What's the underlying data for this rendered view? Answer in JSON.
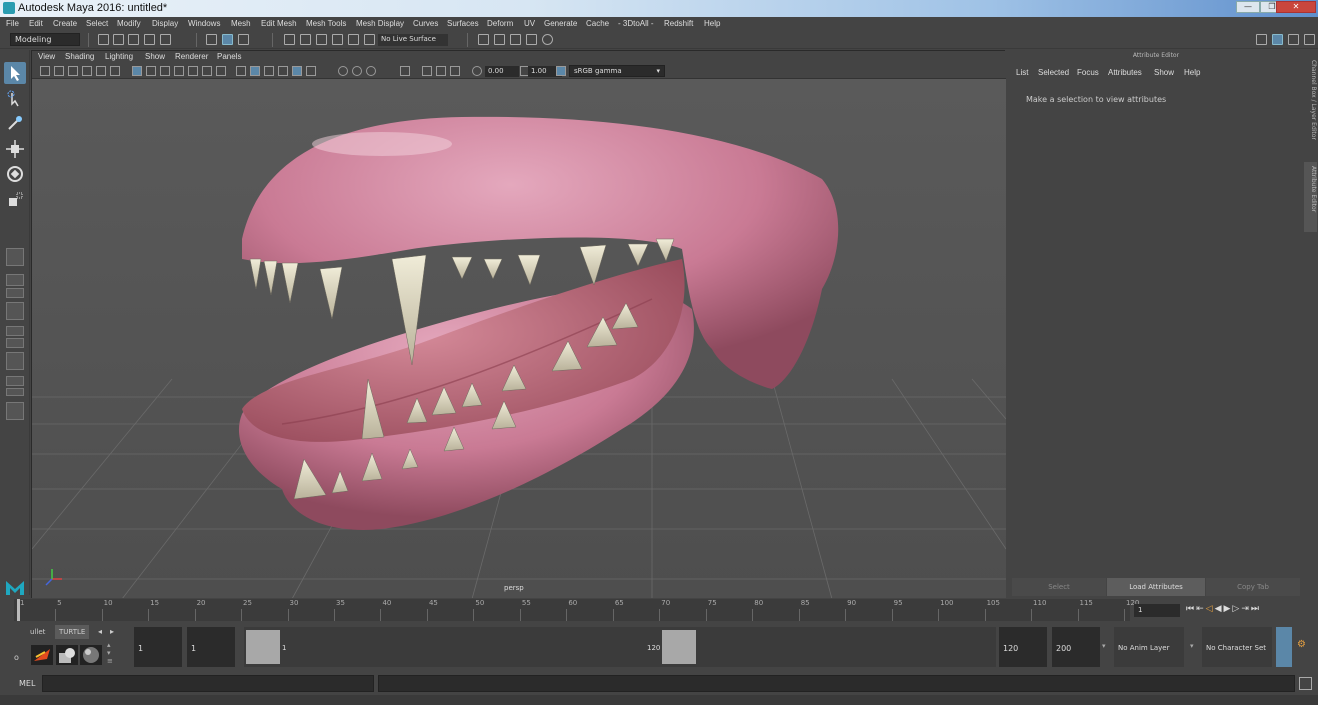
{
  "window": {
    "title": "Autodesk Maya 2016: untitled*"
  },
  "menubar": [
    "File",
    "Edit",
    "Create",
    "Select",
    "Modify",
    "Display",
    "Windows",
    "Mesh",
    "Edit Mesh",
    "Mesh Tools",
    "Mesh Display",
    "Curves",
    "Surfaces",
    "Deform",
    "UV",
    "Generate",
    "Cache",
    "- 3DtoAll -",
    "Redshift",
    "Help"
  ],
  "shelf": {
    "mode": "Modeling",
    "live_surface": "No Live Surface"
  },
  "viewport": {
    "menus": [
      "View",
      "Shading",
      "Lighting",
      "Show",
      "Renderer",
      "Panels"
    ],
    "exposure": "0.00",
    "gamma": "1.00",
    "color_space": "sRGB gamma",
    "camera_label": "persp"
  },
  "attribute_editor": {
    "header": "Attribute Editor",
    "menus": [
      "List",
      "Selected",
      "Focus",
      "Attributes",
      "Show",
      "Help"
    ],
    "message": "Make a selection to view attributes",
    "buttons": {
      "select": "Select",
      "load": "Load Attributes",
      "copy_tab": "Copy Tab"
    }
  },
  "side_tabs": [
    "Channel Box / Layer Editor",
    "Attribute Editor"
  ],
  "timeline": {
    "ticks": [
      "1",
      "5",
      "10",
      "15",
      "20",
      "25",
      "30",
      "35",
      "40",
      "45",
      "50",
      "55",
      "60",
      "65",
      "70",
      "75",
      "80",
      "85",
      "90",
      "95",
      "100",
      "105",
      "110",
      "115",
      "120"
    ],
    "current_frame": "1"
  },
  "range": {
    "shelf_tabs": [
      "ullet",
      "TURTLE"
    ],
    "start_field": "1",
    "playback_start": "1",
    "range_start_label": "1",
    "range_end_label": "120",
    "playback_end": "120",
    "end_field": "200",
    "anim_layer": "No Anim Layer",
    "character_set": "No Character Set"
  },
  "command": {
    "label": "MEL"
  }
}
